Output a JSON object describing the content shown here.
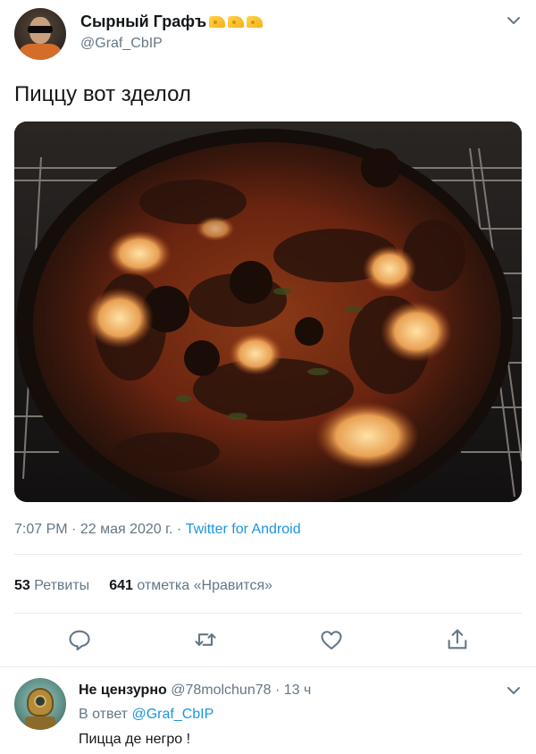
{
  "tweet": {
    "author": {
      "display_name": "Сырный Графъ",
      "emoji": "cheese x3",
      "username": "@Graf_CbIP"
    },
    "text": "Пиццу вот зделол",
    "media_description_icon": "burnt-pizza-photo",
    "meta": {
      "time": "7:07 PM",
      "date": "22 мая 2020 г.",
      "sep": "·",
      "source": "Twitter for Android"
    },
    "stats": {
      "retweets_count": "53",
      "retweets_label": "Ретвиты",
      "likes_count": "641",
      "likes_label": "отметка «Нравится»"
    },
    "actions": [
      "reply-icon",
      "retweet-icon",
      "like-icon",
      "share-icon"
    ]
  },
  "reply": {
    "display_name": "Не цензурно",
    "handle": "@78molchun78",
    "sep": "·",
    "time_ago": "13 ч",
    "reply_to_label": "В ответ",
    "reply_to_mention": "@Graf_CbIP",
    "text": "Пицца де негро !"
  },
  "colors": {
    "accent": "#1b95e0",
    "secondary": "#657786",
    "text": "#14171a",
    "divider": "#e6ecf0"
  }
}
